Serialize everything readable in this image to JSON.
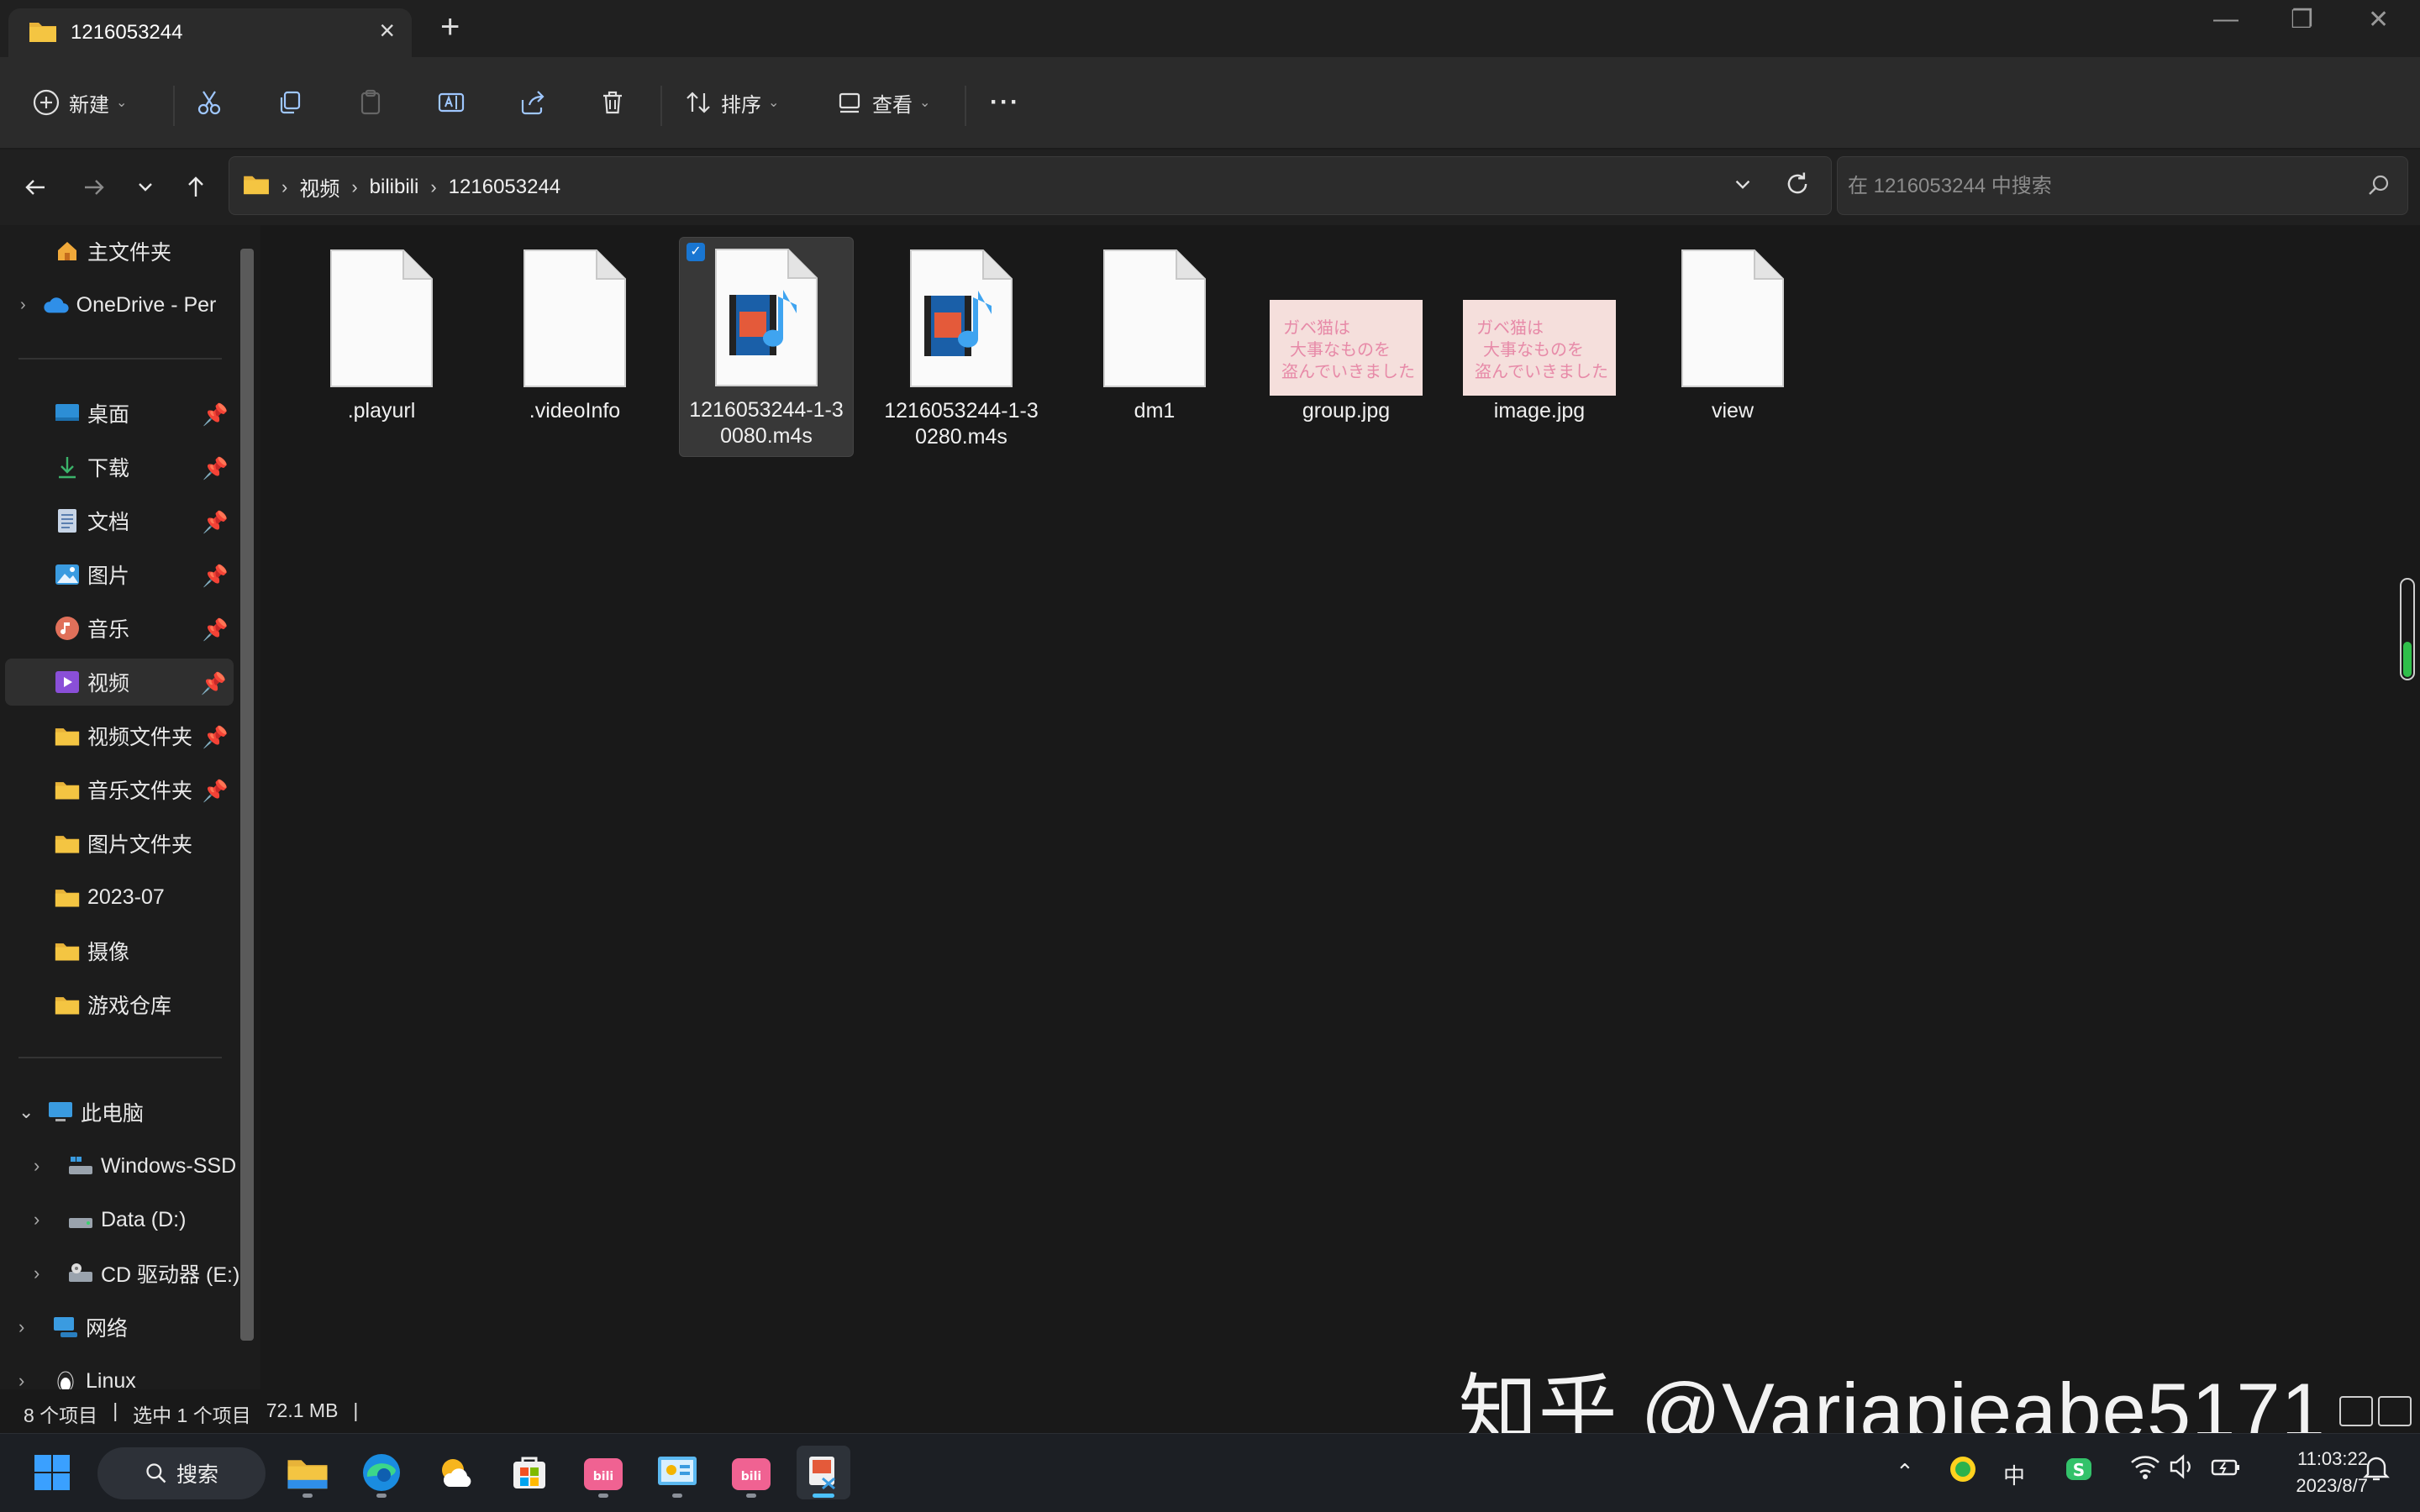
{
  "window": {
    "tab_title": "1216053244",
    "new_tab": "+",
    "close_tab": "×"
  },
  "toolbar": {
    "new_label": "新建",
    "sort_label": "排序",
    "view_label": "查看",
    "more": "···"
  },
  "address": {
    "crumbs": [
      "视频",
      "bilibili",
      "1216053244"
    ],
    "search_placeholder": "在 1216053244 中搜索"
  },
  "sidebar": {
    "home": "主文件夹",
    "onedrive": "OneDrive - Per",
    "quick": [
      "桌面",
      "下载",
      "文档",
      "图片",
      "音乐",
      "视频",
      "视频文件夹",
      "音乐文件夹",
      "图片文件夹",
      "2023-07",
      "摄像",
      "游戏仓库"
    ],
    "this_pc": "此电脑",
    "drives": [
      "Windows-SSD",
      "Data (D:)",
      "CD 驱动器 (E:)"
    ],
    "network": "网络",
    "linux": "Linux"
  },
  "files": [
    {
      "name": ".playurl",
      "type": "blank"
    },
    {
      "name": ".videoInfo",
      "type": "blank"
    },
    {
      "name": "1216053244-1-30080.m4s",
      "type": "media",
      "selected": true
    },
    {
      "name": "1216053244-1-30280.m4s",
      "type": "media"
    },
    {
      "name": "dm1",
      "type": "blank"
    },
    {
      "name": "group.jpg",
      "type": "image"
    },
    {
      "name": "image.jpg",
      "type": "image"
    },
    {
      "name": "view",
      "type": "blank"
    }
  ],
  "thumbnail_text": [
    "ガベ猫は",
    "大事なものを",
    "盗んでいきました"
  ],
  "status": {
    "count": "8 个项目",
    "selection": "选中 1 个项目",
    "size": "72.1 MB"
  },
  "watermark": "知乎 @Variapieabe5171",
  "taskbar": {
    "search_label": "搜索",
    "ime": "中",
    "time": "11:03:22",
    "date": "2023/8/7"
  },
  "colors": {
    "accent": "#4cc2ff",
    "folder": "#f4c542",
    "checkbox": "#1976d2"
  }
}
